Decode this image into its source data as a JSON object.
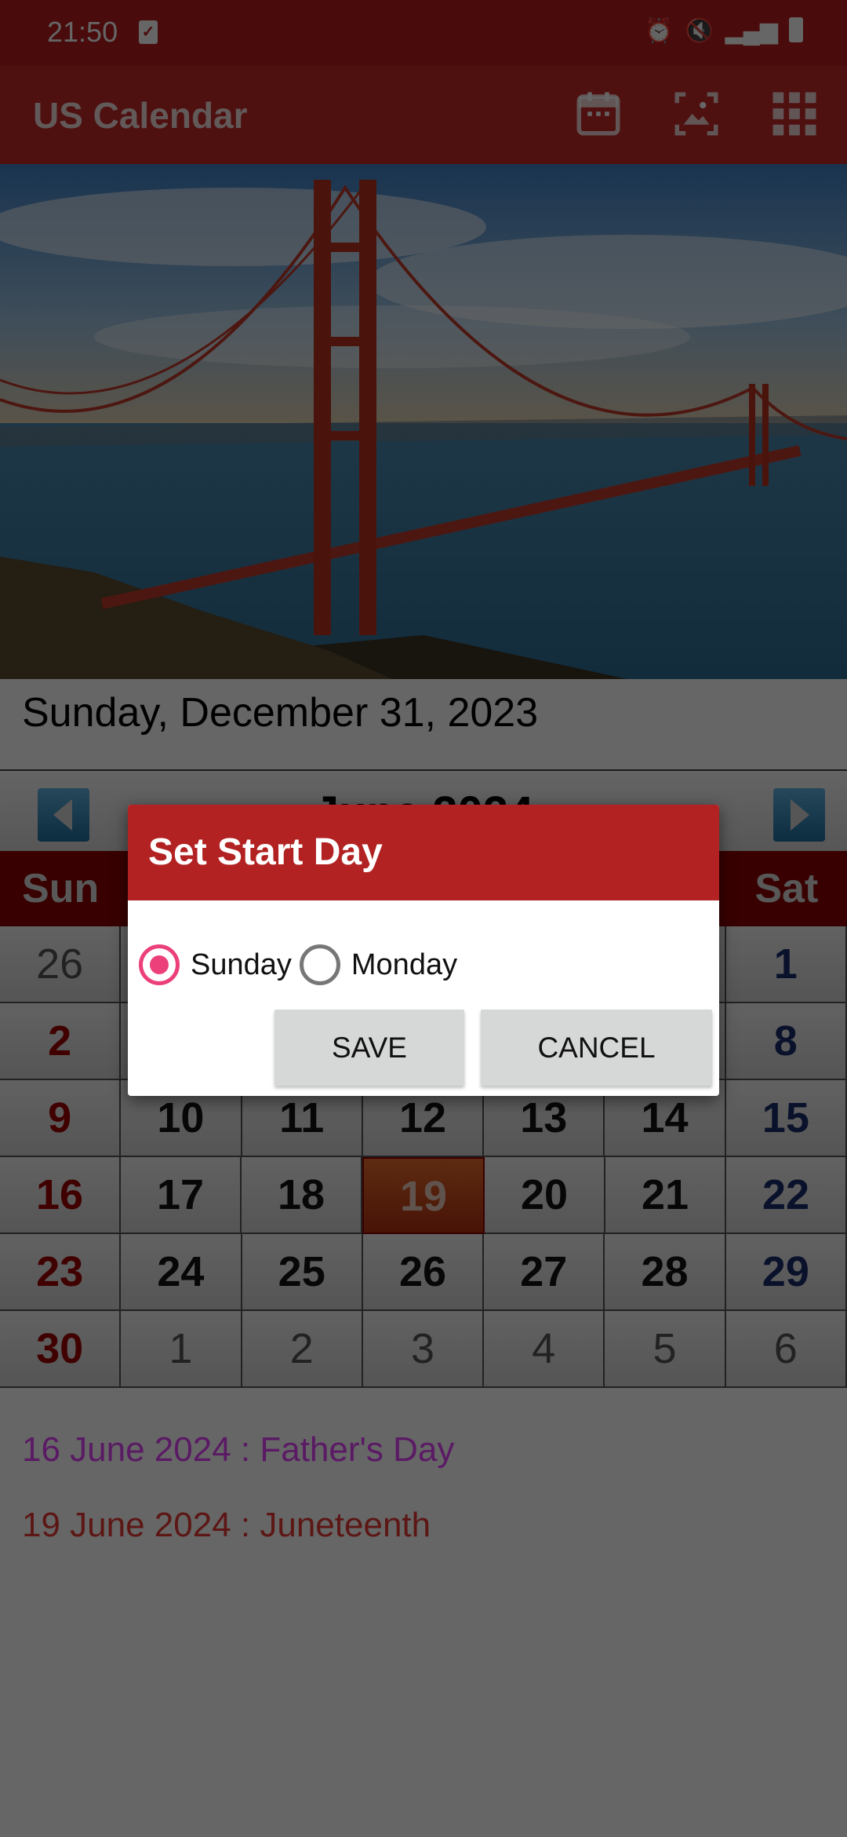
{
  "status_bar": {
    "time": "21:50",
    "icons": [
      "checkbox-notification-icon",
      "alarm-icon",
      "mute-vibrate-icon",
      "signal-icon",
      "battery-icon"
    ]
  },
  "app_bar": {
    "title": "US Calendar",
    "actions": [
      "calendar-icon",
      "wallpaper-icon",
      "grid-menu-icon"
    ]
  },
  "hero_image": "golden-gate-bridge",
  "selected_date": "Sunday, December 31, 2023",
  "calendar": {
    "month_title": "June 2024",
    "weekdays": [
      "Sun",
      "",
      "",
      "",
      "",
      "",
      "Sat"
    ],
    "weeks": [
      [
        {
          "d": "26",
          "t": "other"
        },
        {
          "d": "",
          "t": ""
        },
        {
          "d": "",
          "t": ""
        },
        {
          "d": "",
          "t": ""
        },
        {
          "d": "",
          "t": ""
        },
        {
          "d": "",
          "t": ""
        },
        {
          "d": "1",
          "t": "sat"
        }
      ],
      [
        {
          "d": "2",
          "t": "sun"
        },
        {
          "d": "",
          "t": ""
        },
        {
          "d": "",
          "t": ""
        },
        {
          "d": "",
          "t": ""
        },
        {
          "d": "",
          "t": ""
        },
        {
          "d": "",
          "t": ""
        },
        {
          "d": "8",
          "t": "sat"
        }
      ],
      [
        {
          "d": "9",
          "t": "sun"
        },
        {
          "d": "10",
          "t": ""
        },
        {
          "d": "11",
          "t": ""
        },
        {
          "d": "12",
          "t": ""
        },
        {
          "d": "13",
          "t": ""
        },
        {
          "d": "14",
          "t": ""
        },
        {
          "d": "15",
          "t": "sat"
        }
      ],
      [
        {
          "d": "16",
          "t": "sun"
        },
        {
          "d": "17",
          "t": ""
        },
        {
          "d": "18",
          "t": ""
        },
        {
          "d": "19",
          "t": "today"
        },
        {
          "d": "20",
          "t": ""
        },
        {
          "d": "21",
          "t": ""
        },
        {
          "d": "22",
          "t": "sat"
        }
      ],
      [
        {
          "d": "23",
          "t": "sun"
        },
        {
          "d": "24",
          "t": ""
        },
        {
          "d": "25",
          "t": ""
        },
        {
          "d": "26",
          "t": ""
        },
        {
          "d": "27",
          "t": ""
        },
        {
          "d": "28",
          "t": ""
        },
        {
          "d": "29",
          "t": "sat"
        }
      ],
      [
        {
          "d": "30",
          "t": "sun"
        },
        {
          "d": "1",
          "t": "other"
        },
        {
          "d": "2",
          "t": "other"
        },
        {
          "d": "3",
          "t": "other"
        },
        {
          "d": "4",
          "t": "other"
        },
        {
          "d": "5",
          "t": "other"
        },
        {
          "d": "6",
          "t": "other"
        }
      ]
    ]
  },
  "holidays": [
    {
      "text": "16 June 2024 : Father's Day",
      "color": "#e040fb"
    },
    {
      "text": "19 June 2024 : Juneteenth",
      "color": "#e53935"
    }
  ],
  "dialog": {
    "title": "Set Start Day",
    "options": [
      {
        "label": "Sunday",
        "selected": true
      },
      {
        "label": "Monday",
        "selected": false
      }
    ],
    "save_label": "SAVE",
    "cancel_label": "CANCEL"
  },
  "colors": {
    "accent": "#b22222",
    "radio": "#ec407a"
  }
}
